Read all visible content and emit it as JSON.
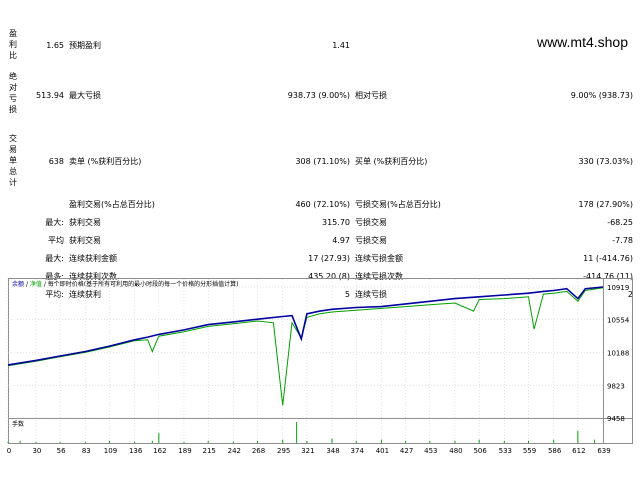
{
  "watermark": "www.mt4.shop",
  "sections": {
    "profit_factor": "盈利比",
    "absolute_dd": "绝对亏损",
    "total_trades": "交易单总计"
  },
  "rows": {
    "r1": {
      "v1": "1.65",
      "l2": "预期盈利",
      "v2": "1.41"
    },
    "r2": {
      "v1": "513.94",
      "l2": "最大亏损",
      "v2": "938.73 (9.00%)",
      "l3": "相对亏损",
      "v3": "9.00% (938.73)"
    },
    "r3": {
      "v1": "638",
      "l2": "卖单 (%获利百分比)",
      "v2": "308 (71.10%)",
      "l3": "买单 (%获利百分比)",
      "v3": "330 (73.03%)"
    },
    "r4": {
      "l2": "盈利交易(%占总百分比)",
      "v2": "460 (72.10%)",
      "l3": "亏损交易(%占总百分比)",
      "v3": "178 (27.90%)"
    },
    "r5": {
      "l1": "最大:",
      "l2": "获利交易",
      "v2": "315.70",
      "l3": "亏损交易",
      "v3": "-68.25"
    },
    "r6": {
      "l1": "平均",
      "l2": "获利交易",
      "v2": "4.97",
      "l3": "亏损交易",
      "v3": "-7.78"
    },
    "r7": {
      "l1": "最大:",
      "l2": "连续获利金额",
      "v2": "17 (27.93)",
      "l3": "连续亏损金额",
      "v3": "11 (-414.76)"
    },
    "r8": {
      "l1": "最多:",
      "l2": "连续获利次数",
      "v2": "435.20 (8)",
      "l3": "连续亏损次数",
      "v3": "-414.76 (11)"
    },
    "r9": {
      "l1": "平均:",
      "l2": "连续获利",
      "v2": "5",
      "l3": "连续亏损",
      "v3": "2"
    }
  },
  "chart": {
    "legend": {
      "balance": "余额",
      "equity": "净值",
      "desc": "每个即时价格(基于所有可利用的最小时段的每一个价格的分形插值计算)"
    },
    "volume_label": "手数",
    "colors": {
      "balance": "#0000a0",
      "equity": "#00a000",
      "volume": "#00a000",
      "grid": "#c8c8c8"
    }
  },
  "chart_data": {
    "type": "line",
    "x_ticks": [
      "0",
      "30",
      "56",
      "83",
      "109",
      "136",
      "162",
      "189",
      "215",
      "242",
      "268",
      "295",
      "321",
      "348",
      "374",
      "401",
      "427",
      "453",
      "480",
      "506",
      "533",
      "559",
      "586",
      "612",
      "639"
    ],
    "y_ticks": [
      "10919",
      "10554",
      "10188",
      "9823",
      "9458"
    ],
    "ylim": [
      9458,
      10919
    ],
    "xlim": [
      0,
      639
    ],
    "series": [
      {
        "name": "余额",
        "x": [
          0,
          30,
          56,
          83,
          109,
          136,
          150,
          162,
          189,
          215,
          242,
          268,
          295,
          305,
          315,
          321,
          335,
          348,
          374,
          401,
          427,
          453,
          480,
          506,
          533,
          559,
          575,
          586,
          600,
          612,
          620,
          639
        ],
        "y": [
          10050,
          10100,
          10150,
          10200,
          10260,
          10330,
          10360,
          10390,
          10440,
          10500,
          10530,
          10560,
          10590,
          10600,
          10340,
          10620,
          10650,
          10670,
          10690,
          10700,
          10730,
          10760,
          10790,
          10810,
          10830,
          10850,
          10870,
          10880,
          10900,
          10790,
          10900,
          10919
        ]
      },
      {
        "name": "净值",
        "x": [
          0,
          30,
          56,
          83,
          109,
          136,
          150,
          155,
          162,
          189,
          215,
          242,
          268,
          285,
          295,
          305,
          315,
          321,
          335,
          348,
          374,
          401,
          427,
          453,
          480,
          500,
          506,
          533,
          559,
          565,
          575,
          586,
          600,
          612,
          620,
          639
        ],
        "y": [
          10040,
          10090,
          10140,
          10190,
          10250,
          10320,
          10330,
          10200,
          10370,
          10420,
          10480,
          10510,
          10540,
          10520,
          9600,
          10520,
          10350,
          10580,
          10620,
          10640,
          10660,
          10680,
          10700,
          10720,
          10740,
          10650,
          10780,
          10790,
          10810,
          10450,
          10840,
          10850,
          10870,
          10760,
          10880,
          10910
        ]
      }
    ],
    "volume": {
      "x": [
        0,
        13,
        30,
        56,
        83,
        109,
        136,
        155,
        162,
        189,
        215,
        242,
        268,
        295,
        310,
        321,
        348,
        374,
        401,
        427,
        453,
        480,
        506,
        533,
        559,
        586,
        612,
        630
      ],
      "y": [
        1,
        2,
        1,
        1,
        1,
        2,
        1,
        2,
        9,
        1,
        2,
        1,
        2,
        3,
        19,
        2,
        4,
        2,
        3,
        2,
        2,
        2,
        3,
        2,
        2,
        3,
        11,
        3
      ]
    }
  }
}
